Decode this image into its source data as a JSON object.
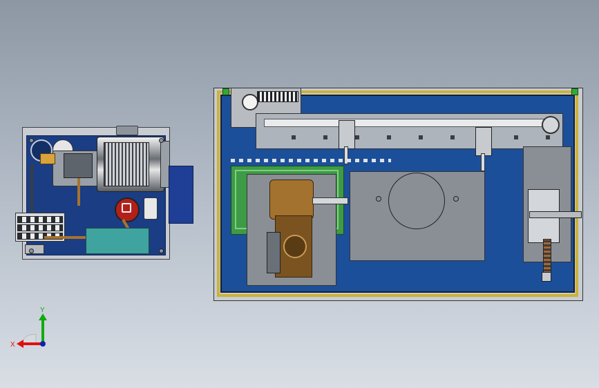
{
  "triad": {
    "x_label": "X",
    "y_label": "Y"
  },
  "colors": {
    "background_top": "#8d97a4",
    "background_bottom": "#d9dee5",
    "plate_blue": "#1a3d84",
    "table_blue": "#1b4f9a",
    "frame_yellow": "#c9b33c",
    "gearbox_bronze": "#a3722f",
    "hose_copper": "#a8732e",
    "estop_red": "#b3201a",
    "manifold_teal": "#3fa39f",
    "axis_x_red": "#d11",
    "axis_y_green": "#1a1",
    "axis_z_blue": "#12a"
  },
  "icons": [
    "emergency-stop-icon",
    "gauge-icon",
    "pulley-icon",
    "coordinate-triad-icon"
  ]
}
